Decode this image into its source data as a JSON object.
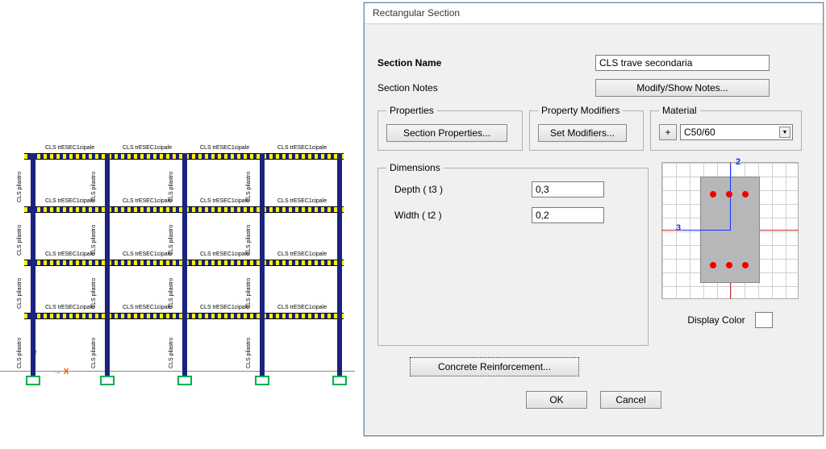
{
  "dialog": {
    "title": "Rectangular Section",
    "section_name_label": "Section Name",
    "section_name_value": "CLS trave secondaria",
    "section_notes_label": "Section Notes",
    "notes_button": "Modify/Show Notes...",
    "groups": {
      "properties_legend": "Properties",
      "properties_button": "Section Properties...",
      "modifiers_legend": "Property Modifiers",
      "modifiers_button": "Set Modifiers...",
      "material_legend": "Material",
      "material_add": "+",
      "material_value": "C50/60"
    },
    "dimensions": {
      "legend": "Dimensions",
      "depth_label": "Depth  ( t3 )",
      "depth_value": "0,3",
      "width_label": "Width  ( t2 )",
      "width_value": "0,2"
    },
    "preview": {
      "axis2": "2",
      "axis3": "3"
    },
    "display_color_label": "Display Color",
    "concrete_button": "Concrete Reinforcement...",
    "ok": "OK",
    "cancel": "Cancel"
  },
  "frame_labels": {
    "beam": "CLS trESEC1cipale",
    "column": "CLS pilastro"
  }
}
